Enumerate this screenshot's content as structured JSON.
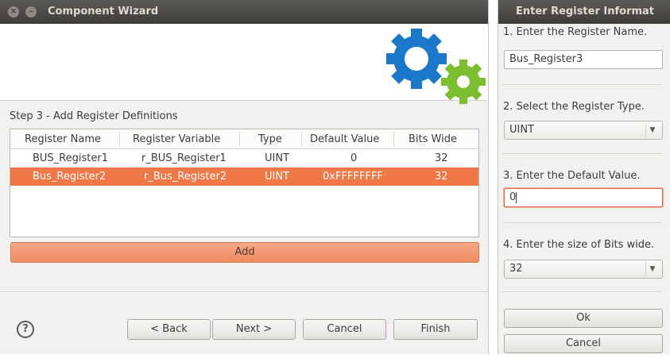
{
  "wizard": {
    "title": "Component Wizard",
    "step_label": "Step 3 - Add Register Definitions",
    "table": {
      "headers": [
        "Register Name",
        "Register Variable",
        "Type",
        "Default Value",
        "Bits Wide"
      ],
      "rows": [
        [
          "BUS_Register1",
          "r_BUS_Register1",
          "UINT",
          "0",
          "32"
        ],
        [
          "Bus_Register2",
          "r_Bus_Register2",
          "UINT",
          "0xFFFFFFFF",
          "32"
        ]
      ],
      "selected_row": 1
    },
    "add_label": "Add",
    "help_symbol": "?",
    "buttons": {
      "back": "< Back",
      "next": "Next >",
      "cancel": "Cancel",
      "finish": "Finish"
    },
    "colors": {
      "selection": "#f07746",
      "gear_blue": "#1a77c9",
      "gear_green": "#7cbf2e"
    }
  },
  "dialog": {
    "title": "Enter Register Informat",
    "name_label": "1. Enter the Register Name.",
    "name_value": "Bus_Register3",
    "type_label": "2. Select the Register Type.",
    "type_value": "UINT",
    "default_label": "3. Enter the Default Value.",
    "default_value": "0",
    "bits_label": "4. Enter the size of Bits wide.",
    "bits_value": "32",
    "ok_label": "Ok",
    "cancel_label": "Cancel"
  }
}
